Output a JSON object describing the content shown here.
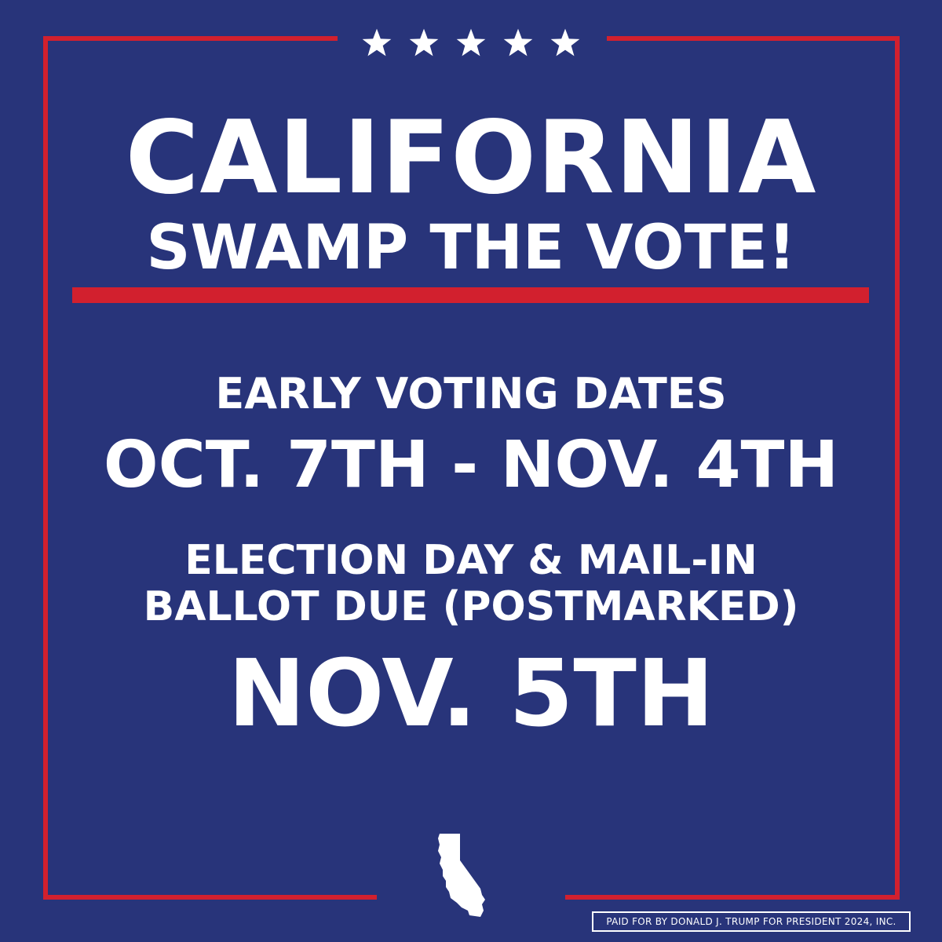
{
  "colors": {
    "background": "#28347a",
    "accent_red": "#d2202e",
    "text": "#ffffff"
  },
  "stars": [
    "star-icon",
    "star-icon",
    "star-icon",
    "star-icon",
    "star-icon"
  ],
  "headline": {
    "line1": "CALIFORNIA",
    "line2": "SWAMP THE VOTE!"
  },
  "early_voting": {
    "label": "EARLY VOTING DATES",
    "dates": "OCT. 7TH - NOV. 4TH"
  },
  "election_day": {
    "label_line1": "ELECTION DAY & MAIL-IN",
    "label_line2": "BALLOT DUE (POSTMARKED)",
    "date": "NOV. 5TH"
  },
  "icon": "california-state-icon",
  "disclaimer": "PAID FOR BY DONALD J. TRUMP FOR PRESIDENT 2024, INC."
}
